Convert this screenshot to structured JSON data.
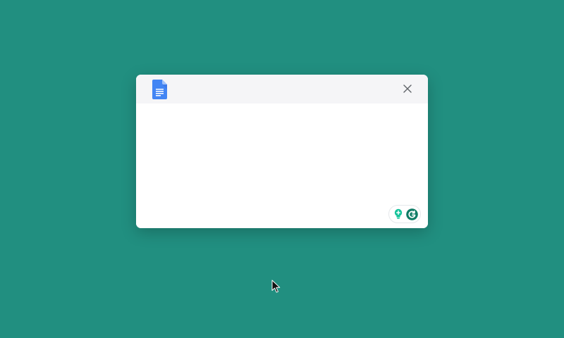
{
  "app": {
    "name": "Google Docs",
    "icon": "google-docs-icon"
  },
  "colors": {
    "desktop_background": "#218f80",
    "dialog_header": "#f5f5f7",
    "docs_blue": "#4285f4",
    "grammarly_green": "#15c39a",
    "grammarly_dark": "#0f7c66",
    "close_icon": "#5f6368"
  },
  "dialog": {
    "header": {
      "close_icon": "close-icon"
    },
    "editor_text": ""
  },
  "grammarly": {
    "suggestion_icon": "bulb-icon",
    "logo_icon": "grammarly-g-icon"
  },
  "cursor": {
    "icon": "arrow-cursor-icon"
  }
}
